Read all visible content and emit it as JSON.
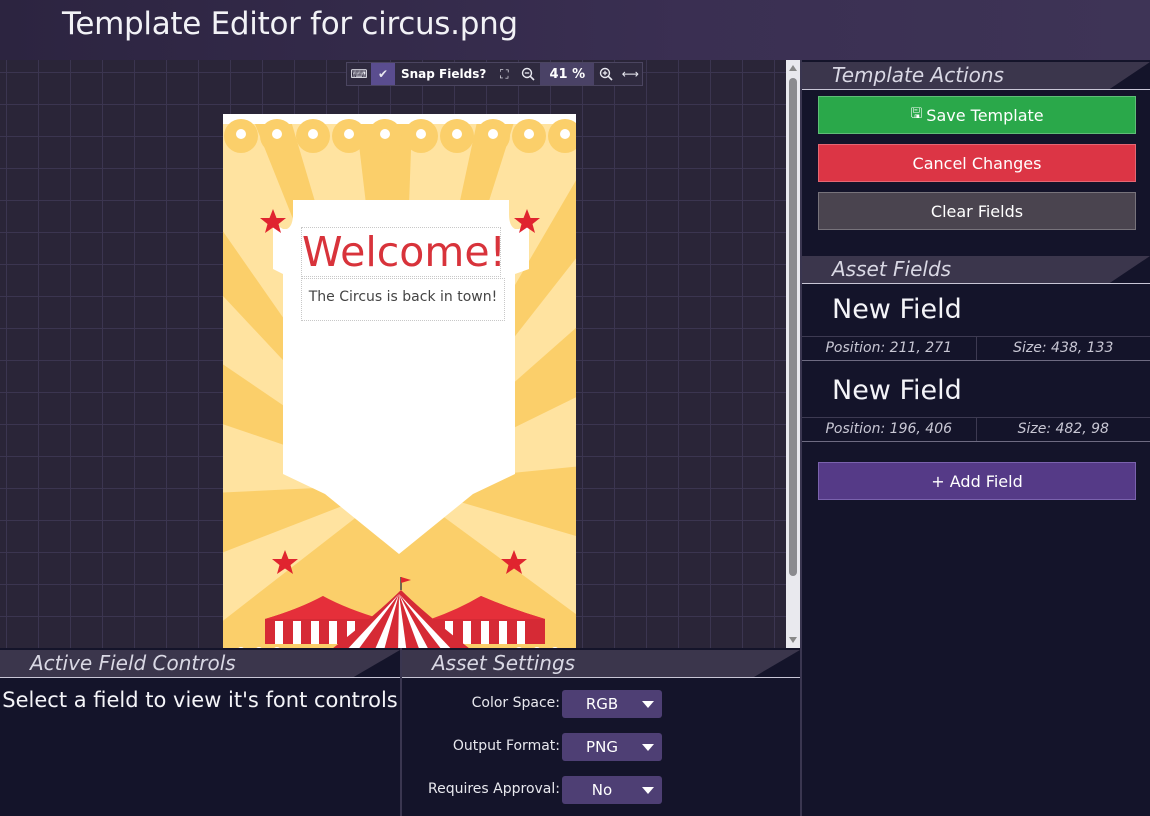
{
  "header": {
    "title": "Template Editor for circus.png"
  },
  "toolbar": {
    "keyboard_icon": "keyboard-icon",
    "snap_label": "Snap Fields?",
    "snap_checked": true,
    "zoom_value": "41 %"
  },
  "poster": {
    "welcome_text": "Welcome!",
    "subtitle_text": "The Circus is back in town!",
    "colors": {
      "background": "#fbcf6a",
      "ray": "#ffe3a0",
      "accent": "#d8333b"
    }
  },
  "template_actions": {
    "title": "Template Actions",
    "save_label": "Save Template",
    "cancel_label": "Cancel Changes",
    "clear_label": "Clear Fields"
  },
  "asset_fields": {
    "title": "Asset Fields",
    "fields": [
      {
        "name": "New Field",
        "position": "Position: 211, 271",
        "size": "Size: 438, 133"
      },
      {
        "name": "New Field",
        "position": "Position: 196, 406",
        "size": "Size: 482, 98"
      }
    ],
    "add_label": "+ Add Field"
  },
  "active_field_controls": {
    "title": "Active Field Controls",
    "message": "Select a field to view it's font controls"
  },
  "asset_settings": {
    "title": "Asset Settings",
    "color_space_label": "Color Space:",
    "color_space_value": "RGB",
    "output_format_label": "Output Format:",
    "output_format_value": "PNG",
    "requires_approval_label": "Requires Approval:",
    "requires_approval_value": "No"
  },
  "theme": {
    "save": "#2aa84a",
    "cancel": "#dc3545",
    "clear": "#4a444f",
    "add": "#553a87"
  }
}
